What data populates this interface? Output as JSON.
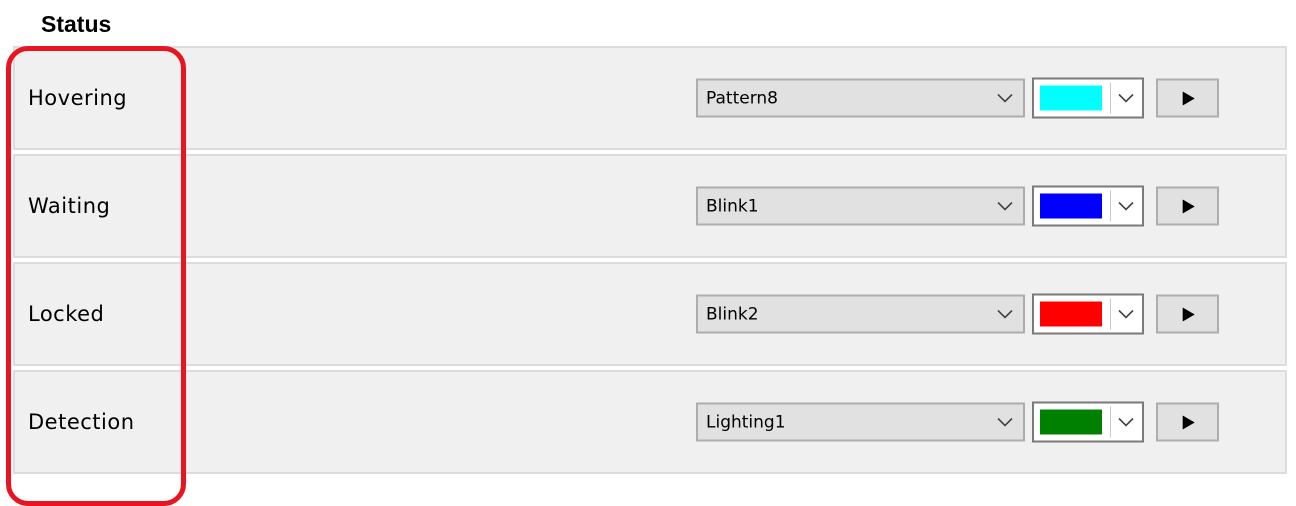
{
  "section": {
    "title": "Status"
  },
  "rows": [
    {
      "label": "Hovering",
      "pattern": "Pattern8",
      "color": "#00ffff",
      "color_name": "cyan"
    },
    {
      "label": "Waiting",
      "pattern": "Blink1",
      "color": "#0000ff",
      "color_name": "blue"
    },
    {
      "label": "Locked",
      "pattern": "Blink2",
      "color": "#ff0000",
      "color_name": "red"
    },
    {
      "label": "Detection",
      "pattern": "Lighting1",
      "color": "#008000",
      "color_name": "green"
    }
  ],
  "icons": {
    "dropdown": "chevron-down-icon",
    "play": "play-icon"
  },
  "theme": {
    "highlight_color": "#e8141f",
    "panel_background": "#f0f0f0"
  }
}
